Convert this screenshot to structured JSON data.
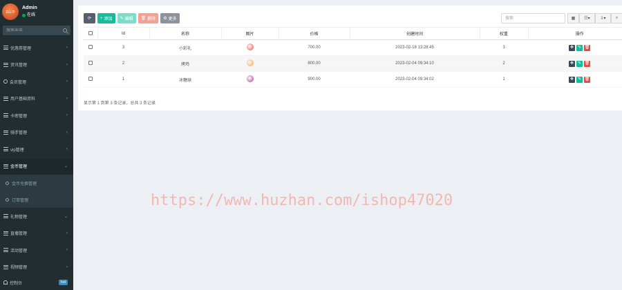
{
  "user": {
    "name": "Admin",
    "status": "在线",
    "avatar_text": "ZLL中"
  },
  "sidebar": {
    "search_placeholder": "搜索菜单",
    "items": [
      {
        "label": "优惠券管理"
      },
      {
        "label": "资讯管理"
      },
      {
        "label": "会员管理"
      },
      {
        "label": "用户基础资料"
      },
      {
        "label": "卡密管理"
      },
      {
        "label": "骑手管理"
      },
      {
        "label": "vip管理"
      },
      {
        "label": "金币管理"
      }
    ],
    "submenu": [
      {
        "label": "金币兑换管理"
      },
      {
        "label": "订单管理"
      }
    ],
    "items_after": [
      {
        "label": "礼物管理"
      },
      {
        "label": "直播管理"
      },
      {
        "label": "活动管理"
      },
      {
        "label": "视频管理"
      }
    ],
    "console": {
      "label": "控制台",
      "badge": "hot"
    }
  },
  "toolbar": {
    "add_label": "添加",
    "edit_label": "编辑",
    "delete_label": "删除",
    "more_label": "更多",
    "search_placeholder": "搜索"
  },
  "table": {
    "headers": [
      "Id",
      "名称",
      "图片",
      "价格",
      "创建时间",
      "权重",
      "操作"
    ],
    "rows": [
      {
        "id": "3",
        "name": "小彩礼",
        "price": "700.00",
        "created": "2023-02-18 13:28:45",
        "weight": "3",
        "img_color": "#e8453c"
      },
      {
        "id": "2",
        "name": "烤鸡",
        "price": "800.00",
        "created": "2023-02-04 09:34:10",
        "weight": "2",
        "img_color": "#f5a142"
      },
      {
        "id": "1",
        "name": "冰糖球",
        "price": "900.00",
        "created": "2023-02-04 09:34:02",
        "weight": "1",
        "img_color": "#b0308c"
      }
    ]
  },
  "footer": {
    "summary": "显示第 1 到第 3 条记录，总共 3 条记录"
  },
  "watermark": "https://www.huzhan.com/ishop47020"
}
